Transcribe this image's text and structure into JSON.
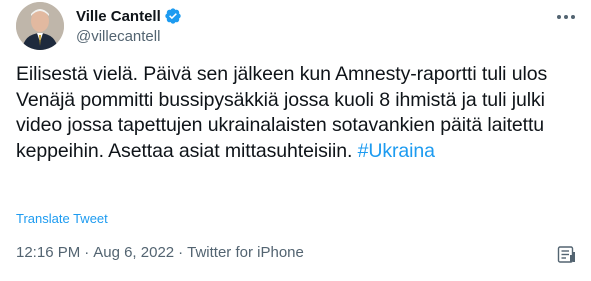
{
  "author": {
    "display_name": "Ville Cantell",
    "handle": "@villecantell",
    "verified": true,
    "avatar_icon": "profile-photo"
  },
  "tweet": {
    "text_before_hashtag": "Eilisestä vielä. Päivä sen jälkeen kun Amnesty-raportti tuli ulos Venäjä pommitti bussipysäkkiä jossa kuoli 8 ihmistä ja tuli julki video jossa tapettujen ukrainalaisten sotavankien päitä laitettu keppeihin. Asettaa asiat mittasuhteisiin.",
    "hashtag": "#Ukraina",
    "translate_label": "Translate Tweet"
  },
  "meta": {
    "time": "12:16 PM",
    "separator": "·",
    "date": "Aug 6, 2022",
    "source": "Twitter for iPhone"
  },
  "icons": {
    "verified": "verified-badge-icon",
    "more": "more-options-icon",
    "analytics": "analytics-icon"
  },
  "colors": {
    "accent": "#1d9bf0",
    "text_primary": "#0f1419",
    "text_secondary": "#536471",
    "background": "#ffffff"
  }
}
